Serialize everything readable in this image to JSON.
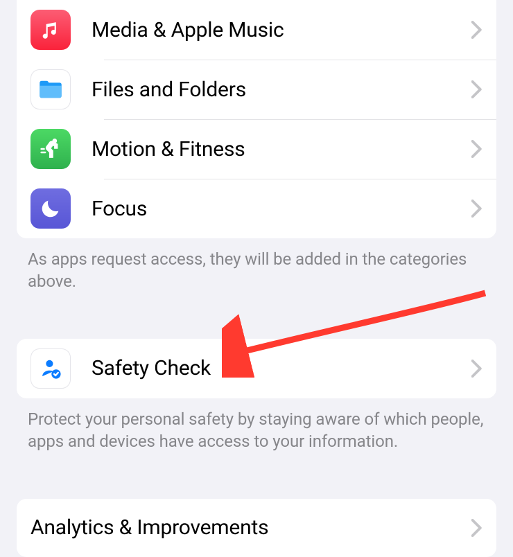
{
  "group1": {
    "items": [
      {
        "label": "Media & Apple Music"
      },
      {
        "label": "Files and Folders"
      },
      {
        "label": "Motion & Fitness"
      },
      {
        "label": "Focus"
      }
    ],
    "footer": "As apps request access, they will be added in the categories above."
  },
  "group2": {
    "items": [
      {
        "label": "Safety Check"
      }
    ],
    "footer": "Protect your personal safety by staying aware of which people, apps and devices have access to your information."
  },
  "group3": {
    "items": [
      {
        "label": "Analytics & Improvements"
      }
    ]
  },
  "colors": {
    "music": "#fc3259",
    "files": "#1e9af7",
    "fitness": "#34c759",
    "focus": "#5856d6",
    "safety": "#0b7cff",
    "arrow": "#ff3a2f"
  }
}
